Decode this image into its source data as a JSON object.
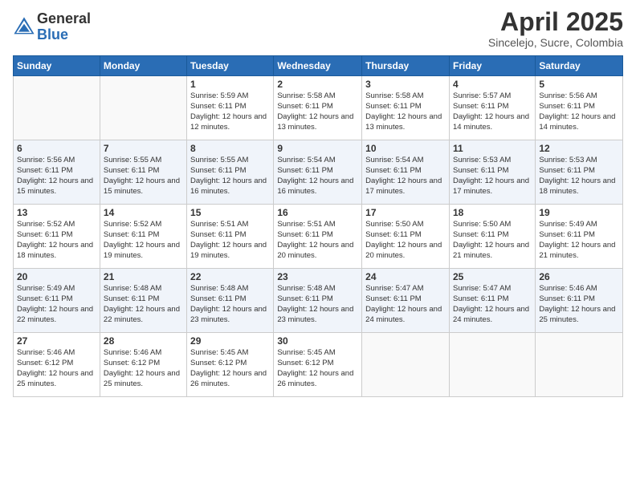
{
  "header": {
    "logo_general": "General",
    "logo_blue": "Blue",
    "title": "April 2025",
    "location": "Sincelejo, Sucre, Colombia"
  },
  "columns": [
    "Sunday",
    "Monday",
    "Tuesday",
    "Wednesday",
    "Thursday",
    "Friday",
    "Saturday"
  ],
  "weeks": [
    [
      {
        "day": "",
        "info": ""
      },
      {
        "day": "",
        "info": ""
      },
      {
        "day": "1",
        "info": "Sunrise: 5:59 AM\nSunset: 6:11 PM\nDaylight: 12 hours and 12 minutes."
      },
      {
        "day": "2",
        "info": "Sunrise: 5:58 AM\nSunset: 6:11 PM\nDaylight: 12 hours and 13 minutes."
      },
      {
        "day": "3",
        "info": "Sunrise: 5:58 AM\nSunset: 6:11 PM\nDaylight: 12 hours and 13 minutes."
      },
      {
        "day": "4",
        "info": "Sunrise: 5:57 AM\nSunset: 6:11 PM\nDaylight: 12 hours and 14 minutes."
      },
      {
        "day": "5",
        "info": "Sunrise: 5:56 AM\nSunset: 6:11 PM\nDaylight: 12 hours and 14 minutes."
      }
    ],
    [
      {
        "day": "6",
        "info": "Sunrise: 5:56 AM\nSunset: 6:11 PM\nDaylight: 12 hours and 15 minutes."
      },
      {
        "day": "7",
        "info": "Sunrise: 5:55 AM\nSunset: 6:11 PM\nDaylight: 12 hours and 15 minutes."
      },
      {
        "day": "8",
        "info": "Sunrise: 5:55 AM\nSunset: 6:11 PM\nDaylight: 12 hours and 16 minutes."
      },
      {
        "day": "9",
        "info": "Sunrise: 5:54 AM\nSunset: 6:11 PM\nDaylight: 12 hours and 16 minutes."
      },
      {
        "day": "10",
        "info": "Sunrise: 5:54 AM\nSunset: 6:11 PM\nDaylight: 12 hours and 17 minutes."
      },
      {
        "day": "11",
        "info": "Sunrise: 5:53 AM\nSunset: 6:11 PM\nDaylight: 12 hours and 17 minutes."
      },
      {
        "day": "12",
        "info": "Sunrise: 5:53 AM\nSunset: 6:11 PM\nDaylight: 12 hours and 18 minutes."
      }
    ],
    [
      {
        "day": "13",
        "info": "Sunrise: 5:52 AM\nSunset: 6:11 PM\nDaylight: 12 hours and 18 minutes."
      },
      {
        "day": "14",
        "info": "Sunrise: 5:52 AM\nSunset: 6:11 PM\nDaylight: 12 hours and 19 minutes."
      },
      {
        "day": "15",
        "info": "Sunrise: 5:51 AM\nSunset: 6:11 PM\nDaylight: 12 hours and 19 minutes."
      },
      {
        "day": "16",
        "info": "Sunrise: 5:51 AM\nSunset: 6:11 PM\nDaylight: 12 hours and 20 minutes."
      },
      {
        "day": "17",
        "info": "Sunrise: 5:50 AM\nSunset: 6:11 PM\nDaylight: 12 hours and 20 minutes."
      },
      {
        "day": "18",
        "info": "Sunrise: 5:50 AM\nSunset: 6:11 PM\nDaylight: 12 hours and 21 minutes."
      },
      {
        "day": "19",
        "info": "Sunrise: 5:49 AM\nSunset: 6:11 PM\nDaylight: 12 hours and 21 minutes."
      }
    ],
    [
      {
        "day": "20",
        "info": "Sunrise: 5:49 AM\nSunset: 6:11 PM\nDaylight: 12 hours and 22 minutes."
      },
      {
        "day": "21",
        "info": "Sunrise: 5:48 AM\nSunset: 6:11 PM\nDaylight: 12 hours and 22 minutes."
      },
      {
        "day": "22",
        "info": "Sunrise: 5:48 AM\nSunset: 6:11 PM\nDaylight: 12 hours and 23 minutes."
      },
      {
        "day": "23",
        "info": "Sunrise: 5:48 AM\nSunset: 6:11 PM\nDaylight: 12 hours and 23 minutes."
      },
      {
        "day": "24",
        "info": "Sunrise: 5:47 AM\nSunset: 6:11 PM\nDaylight: 12 hours and 24 minutes."
      },
      {
        "day": "25",
        "info": "Sunrise: 5:47 AM\nSunset: 6:11 PM\nDaylight: 12 hours and 24 minutes."
      },
      {
        "day": "26",
        "info": "Sunrise: 5:46 AM\nSunset: 6:11 PM\nDaylight: 12 hours and 25 minutes."
      }
    ],
    [
      {
        "day": "27",
        "info": "Sunrise: 5:46 AM\nSunset: 6:12 PM\nDaylight: 12 hours and 25 minutes."
      },
      {
        "day": "28",
        "info": "Sunrise: 5:46 AM\nSunset: 6:12 PM\nDaylight: 12 hours and 25 minutes."
      },
      {
        "day": "29",
        "info": "Sunrise: 5:45 AM\nSunset: 6:12 PM\nDaylight: 12 hours and 26 minutes."
      },
      {
        "day": "30",
        "info": "Sunrise: 5:45 AM\nSunset: 6:12 PM\nDaylight: 12 hours and 26 minutes."
      },
      {
        "day": "",
        "info": ""
      },
      {
        "day": "",
        "info": ""
      },
      {
        "day": "",
        "info": ""
      }
    ]
  ]
}
